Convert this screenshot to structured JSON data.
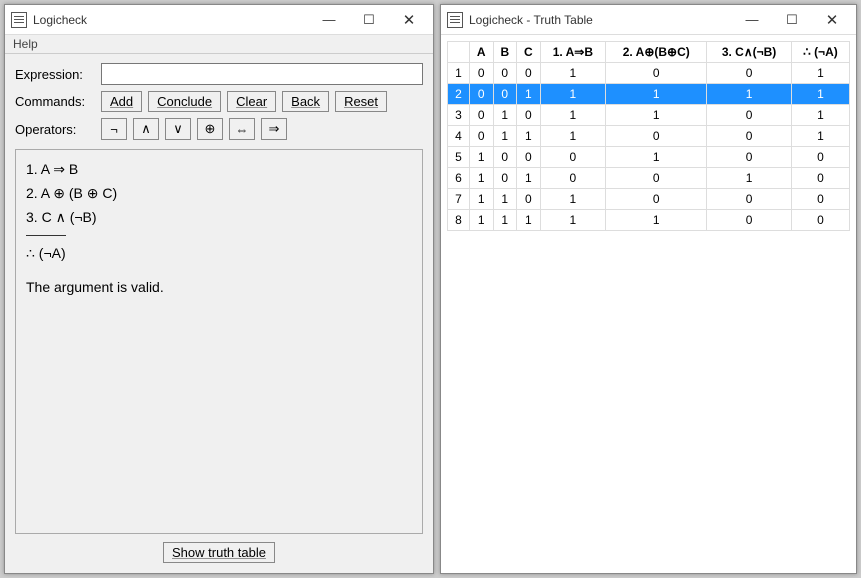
{
  "leftWindow": {
    "title": "Logicheck",
    "menu": {
      "help": "Help"
    },
    "labels": {
      "expression": "Expression:",
      "commands": "Commands:",
      "operators": "Operators:"
    },
    "expressionValue": "",
    "commands": {
      "add": "Add",
      "conclude": "Conclude",
      "clear": "Clear",
      "back": "Back",
      "reset": "Reset"
    },
    "operators": {
      "not": "¬",
      "and": "∧",
      "or": "∨",
      "xor": "⊕",
      "iff": "⇔",
      "implies": "⇒"
    },
    "premises": {
      "p1": "1. A ⇒ B",
      "p2": "2. A ⊕ (B ⊕ C)",
      "p3": "3. C ∧ (¬B)",
      "conclusion": "∴ (¬A)",
      "result": "The argument is valid."
    },
    "showTruth": "Show truth table"
  },
  "rightWindow": {
    "title": "Logicheck - Truth Table",
    "headers": {
      "A": "A",
      "B": "B",
      "C": "C",
      "h1": "1.  A⇒B",
      "h2": "2.  A⊕(B⊕C)",
      "h3": "3.  C∧(¬B)",
      "hc": "∴  (¬A)"
    },
    "rows": [
      {
        "n": "1",
        "A": "0",
        "B": "0",
        "C": "0",
        "c1": "1",
        "c2": "0",
        "c3": "0",
        "cc": "1",
        "sel": false
      },
      {
        "n": "2",
        "A": "0",
        "B": "0",
        "C": "1",
        "c1": "1",
        "c2": "1",
        "c3": "1",
        "cc": "1",
        "sel": true
      },
      {
        "n": "3",
        "A": "0",
        "B": "1",
        "C": "0",
        "c1": "1",
        "c2": "1",
        "c3": "0",
        "cc": "1",
        "sel": false
      },
      {
        "n": "4",
        "A": "0",
        "B": "1",
        "C": "1",
        "c1": "1",
        "c2": "0",
        "c3": "0",
        "cc": "1",
        "sel": false
      },
      {
        "n": "5",
        "A": "1",
        "B": "0",
        "C": "0",
        "c1": "0",
        "c2": "1",
        "c3": "0",
        "cc": "0",
        "sel": false
      },
      {
        "n": "6",
        "A": "1",
        "B": "0",
        "C": "1",
        "c1": "0",
        "c2": "0",
        "c3": "1",
        "cc": "0",
        "sel": false
      },
      {
        "n": "7",
        "A": "1",
        "B": "1",
        "C": "0",
        "c1": "1",
        "c2": "0",
        "c3": "0",
        "cc": "0",
        "sel": false
      },
      {
        "n": "8",
        "A": "1",
        "B": "1",
        "C": "1",
        "c1": "1",
        "c2": "1",
        "c3": "0",
        "cc": "0",
        "sel": false
      }
    ]
  }
}
